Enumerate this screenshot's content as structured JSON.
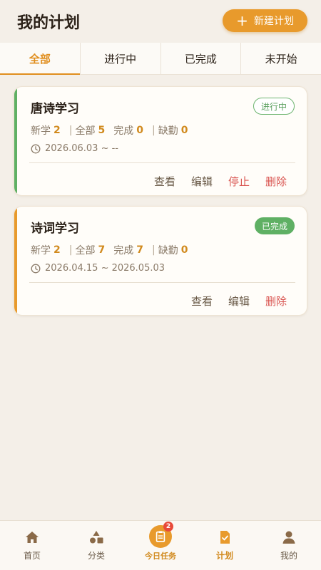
{
  "header": {
    "title": "我的计划",
    "new_plan_label": "新建计划"
  },
  "tabs": [
    {
      "label": "全部",
      "active": true
    },
    {
      "label": "进行中",
      "active": false
    },
    {
      "label": "已完成",
      "active": false
    },
    {
      "label": "未开始",
      "active": false
    }
  ],
  "stat_labels": {
    "new": "新学",
    "all": "全部",
    "done": "完成",
    "absent": "缺勤",
    "sep": "|"
  },
  "plans": [
    {
      "title": "唐诗学习",
      "status": "进行中",
      "status_style": "outline",
      "bar_color": "#5fb064",
      "new": "2",
      "all": "5",
      "done": "0",
      "absent": "0",
      "date_range": "2026.06.03 ~ --",
      "actions": [
        "查看",
        "编辑",
        "停止",
        "删除"
      ]
    },
    {
      "title": "诗词学习",
      "status": "已完成",
      "status_style": "solid",
      "bar_color": "#e89a2c",
      "new": "2",
      "all": "7",
      "done": "7",
      "absent": "0",
      "date_range": "2026.04.15 ~ 2026.05.03",
      "actions": [
        "查看",
        "编辑",
        "删除"
      ]
    }
  ],
  "bottom_nav": {
    "home": "首页",
    "category": "分类",
    "today": "今日任务",
    "today_badge": "2",
    "plan": "计划",
    "mine": "我的"
  },
  "colors": {
    "accent": "#e89a2c",
    "success": "#5fb064",
    "danger": "#d9534f",
    "background": "#f4efe8"
  }
}
